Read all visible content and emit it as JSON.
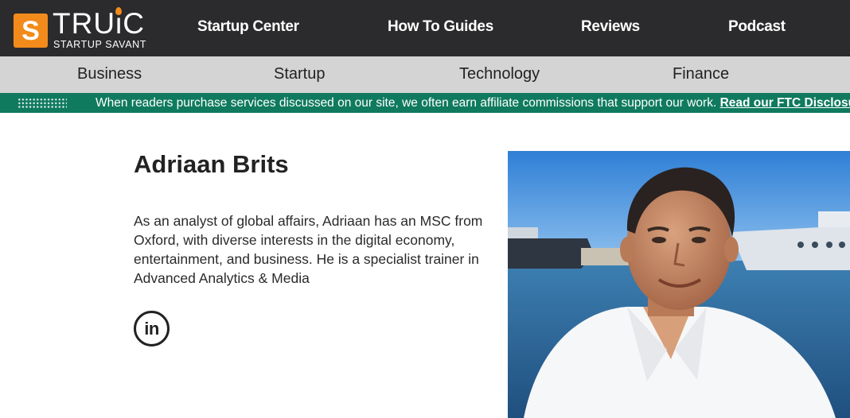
{
  "brand": {
    "logo_letter": "S",
    "name": "TRUiC",
    "tagline": "STARTUP SAVANT",
    "accent_color": "#f28b1c"
  },
  "top_nav": {
    "items": [
      {
        "label": "Startup Center"
      },
      {
        "label": "How To Guides"
      },
      {
        "label": "Reviews"
      },
      {
        "label": "Podcast"
      }
    ]
  },
  "category_nav": {
    "items": [
      {
        "label": "Business"
      },
      {
        "label": "Startup"
      },
      {
        "label": "Technology"
      },
      {
        "label": "Finance"
      }
    ]
  },
  "disclosure": {
    "text": "When readers purchase services discussed on our site, we often earn affiliate commissions that support our work.",
    "link_label": "Read our FTC Disclosure",
    "bar_color": "#0f7a5e"
  },
  "author": {
    "name": "Adriaan Brits",
    "bio": "As an analyst of global affairs, Adriaan has an MSC from Oxford, with diverse interests in the digital economy, entertainment, and business. He is a specialist trainer in Advanced Analytics & Media",
    "social": {
      "linkedin_label": "in",
      "icon": "linkedin-icon"
    }
  }
}
